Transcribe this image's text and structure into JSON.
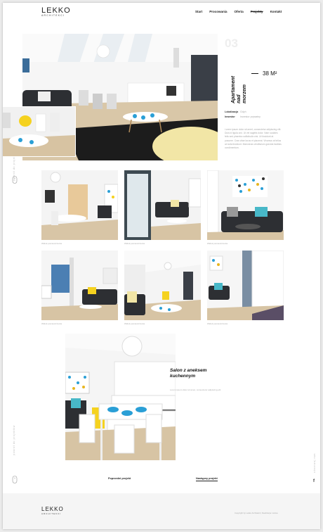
{
  "brand": {
    "name": "LEKKO",
    "subtitle": "ARCHITEKCI"
  },
  "nav": {
    "items": [
      "Start",
      "Procowania",
      "Oferta",
      "Projekty",
      "Kontakt"
    ],
    "active": "Projekty"
  },
  "project": {
    "number": "03",
    "title_line1": "Apartament",
    "title_line2": "nad morzem",
    "area": "38 M²",
    "location_label": "Lokalizacja",
    "location_value": "Gdyń",
    "investor_label": "Inwestor",
    "investor_value": "Inwestor prywatny",
    "description": "Lorem ipsum dolor sit amet, consectetur adipiscing elit. Duis id ligula orci. Ut vel sagittis dolor. Nam sodales felis sed pharetra sollicitudin nisi. Ut tincidunt at posuere. Cras vitae lacus et placerat. Vivamus at tellus at nulla tincidunt. Maecenas vestibulum gravida facilisis condimentum."
  },
  "gallery_captions": [
    "Widok pomieszczenia",
    "Widok pomieszczenia",
    "Widok pomieszczenia",
    "Widok pomieszczenia",
    "Widok pomieszczenia",
    "Widok pomieszczenia"
  ],
  "feature": {
    "title_line1": "Salon z aneksem",
    "title_line2": "kuchennym",
    "subtitle": "Lorem ipsum dolor sit amet, consectetur adipiscing elit"
  },
  "pager": {
    "prev": "Poprzedni projekt",
    "next": "Następny projekt"
  },
  "side_left": "powrót do projektów",
  "side_right": "obserwuj nas",
  "footer": {
    "copyright": "Copyright by Lekko Architekci   |   Realizacja: nazwa"
  },
  "colors": {
    "accent_blue": "#2a9fd6",
    "accent_yellow": "#f5d21f",
    "dark": "#222222"
  }
}
